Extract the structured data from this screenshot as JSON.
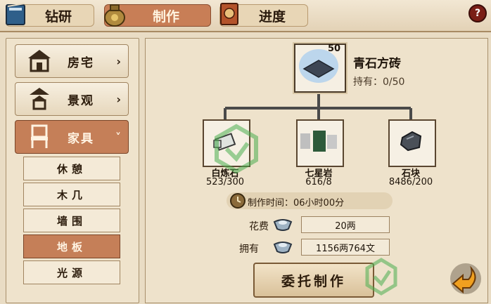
{
  "tabs": [
    {
      "label": "钻研",
      "icon": "book-icon"
    },
    {
      "label": "制作",
      "icon": "money-bag-icon"
    },
    {
      "label": "进度",
      "icon": "scroll-book-icon"
    }
  ],
  "help_label": "?",
  "categories": [
    {
      "label": "房宅",
      "chevron": "›",
      "icon": "house-icon"
    },
    {
      "label": "景观",
      "chevron": "›",
      "icon": "pagoda-icon"
    },
    {
      "label": "家具",
      "chevron": "˅",
      "icon": "chair-icon"
    }
  ],
  "subcategories": [
    "休憩",
    "木几",
    "墙围",
    "地板",
    "光源"
  ],
  "active_subcategory": "地板",
  "product": {
    "name": "青石方砖",
    "count_badge": "50",
    "owned_label": "持有：0/50",
    "icon": "stone-tile-icon"
  },
  "materials": [
    {
      "name": "白炼石",
      "count": "523/300",
      "icon": "white-stone-icon"
    },
    {
      "name": "七星岩",
      "count": "616/8",
      "icon": "seven-star-rock-icon"
    },
    {
      "name": "石块",
      "count": "8486/200",
      "icon": "stone-block-icon"
    }
  ],
  "craft_time": "制作时间：06小时00分",
  "cost": {
    "label": "花费",
    "value": "20两"
  },
  "owned_money": {
    "label": "拥有",
    "value": "1156两764文"
  },
  "commission_button": "委托制作",
  "colors": {
    "accent": "#c57f58",
    "panel": "#eee2cb",
    "border": "#5a4630"
  }
}
